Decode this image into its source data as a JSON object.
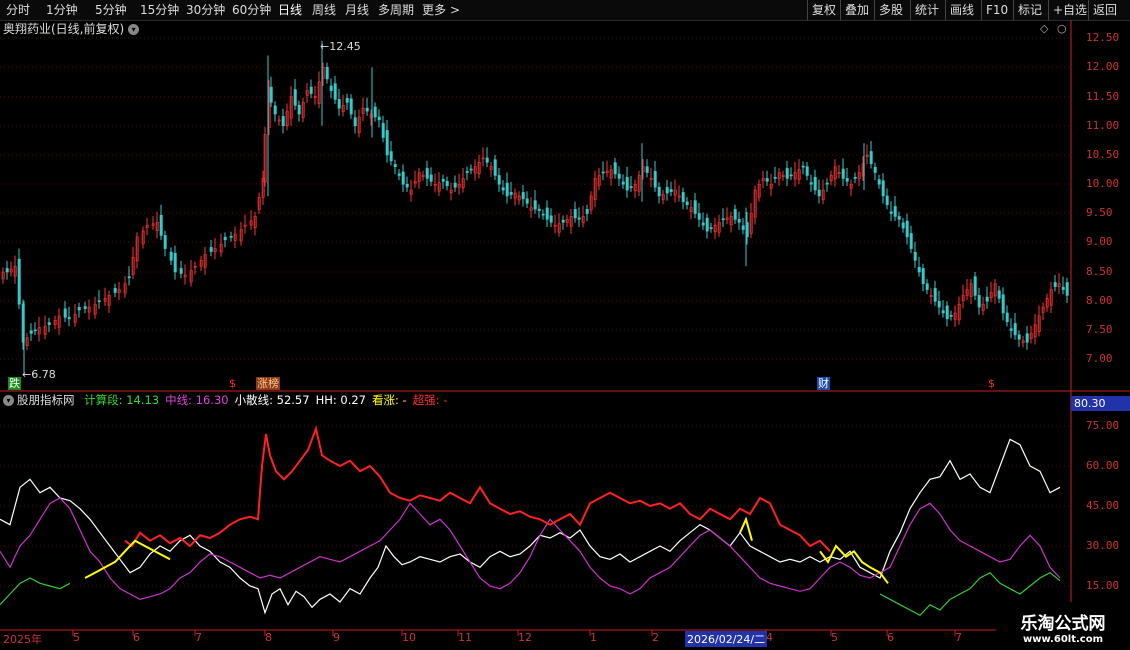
{
  "toolbar": {
    "periods": [
      "分时",
      "1分钟",
      "5分钟",
      "15分钟",
      "30分钟",
      "60分钟",
      "日线",
      "周线",
      "月线",
      "多周期",
      "更多"
    ],
    "more_arrow": ">",
    "right": [
      "复权",
      "叠加",
      "多股",
      "统计",
      "画线",
      "F10",
      "标记",
      "+自选",
      "返回"
    ]
  },
  "stock": {
    "title": "奥翔药业(日线,前复权)",
    "high_label": "12.45",
    "low_label": "6.78"
  },
  "price_axis": [
    "12.50",
    "12.00",
    "11.50",
    "11.00",
    "10.50",
    "10.00",
    "9.50",
    "9.00",
    "8.50",
    "8.00",
    "7.50",
    "7.00"
  ],
  "markers": {
    "die": "跌",
    "dollar": "$",
    "zhangbang": "涨榜",
    "cai": "财",
    "dollar2": "$"
  },
  "indicator": {
    "name": "股朋指标网",
    "items": [
      {
        "label": "计算段",
        "value": "14.13",
        "color": "#33dd33"
      },
      {
        "label": "中线",
        "value": "16.30",
        "color": "#dd44dd"
      },
      {
        "label": "小散线",
        "value": "52.57",
        "color": "#ffffff"
      },
      {
        "label": "HH",
        "value": "0.27",
        "color": "#ffffff"
      },
      {
        "label": "看涨",
        "value": "-",
        "color": "#ffff00"
      },
      {
        "label": "超强",
        "value": "-",
        "color": "#ff3333"
      }
    ],
    "axis": [
      "75.00",
      "60.00",
      "45.00",
      "30.00",
      "15.00"
    ],
    "current": "80.30"
  },
  "dates": [
    "2025年",
    "5",
    "6",
    "7",
    "8",
    "9",
    "10",
    "11",
    "12",
    "1",
    "2",
    "2026/02/24/二",
    "4",
    "5",
    "6",
    "7"
  ],
  "watermark": {
    "title": "乐淘公式网",
    "url": "www.60lt.com"
  },
  "colors": {
    "up": "#ff3333",
    "down": "#33cccc",
    "grid": "#8b0000"
  },
  "chart_data": {
    "type": "line",
    "price_range": [
      6.78,
      12.45
    ],
    "indicator_range": [
      0,
      80.3
    ]
  }
}
